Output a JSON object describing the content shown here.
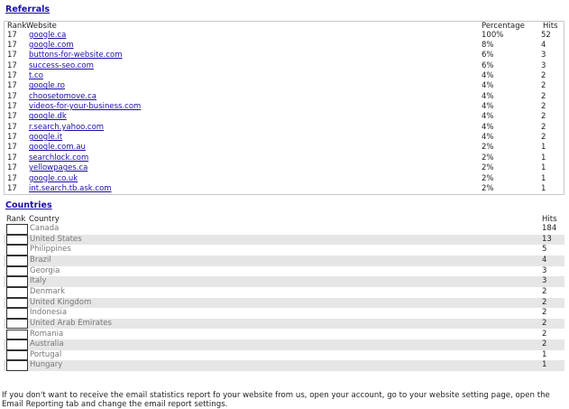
{
  "referrals": {
    "title": "Referrals",
    "headers": {
      "rank": "Rank",
      "website": "Website",
      "percentage": "Percentage",
      "hits": "Hits"
    },
    "rows": [
      {
        "rank": "17",
        "website": "google.ca",
        "percentage": "100%",
        "hits": "52"
      },
      {
        "rank": "17",
        "website": "google.com",
        "percentage": "8%",
        "hits": "4"
      },
      {
        "rank": "17",
        "website": "buttons-for-website.com",
        "percentage": "6%",
        "hits": "3"
      },
      {
        "rank": "17",
        "website": "success-seo.com",
        "percentage": "6%",
        "hits": "3"
      },
      {
        "rank": "17",
        "website": "t.co",
        "percentage": "4%",
        "hits": "2"
      },
      {
        "rank": "17",
        "website": "google.ro",
        "percentage": "4%",
        "hits": "2"
      },
      {
        "rank": "17",
        "website": "choosetomove.ca",
        "percentage": "4%",
        "hits": "2"
      },
      {
        "rank": "17",
        "website": "videos-for-your-business.com",
        "percentage": "4%",
        "hits": "2"
      },
      {
        "rank": "17",
        "website": "google.dk",
        "percentage": "4%",
        "hits": "2"
      },
      {
        "rank": "17",
        "website": "r.search.yahoo.com",
        "percentage": "4%",
        "hits": "2"
      },
      {
        "rank": "17",
        "website": "google.it",
        "percentage": "4%",
        "hits": "2"
      },
      {
        "rank": "17",
        "website": "google.com.au",
        "percentage": "2%",
        "hits": "1"
      },
      {
        "rank": "17",
        "website": "searchlock.com",
        "percentage": "2%",
        "hits": "1"
      },
      {
        "rank": "17",
        "website": "yellowpages.ca",
        "percentage": "2%",
        "hits": "1"
      },
      {
        "rank": "17",
        "website": "google.co.uk",
        "percentage": "2%",
        "hits": "1"
      },
      {
        "rank": "17",
        "website": "int.search.tb.ask.com",
        "percentage": "2%",
        "hits": "1"
      }
    ]
  },
  "countries": {
    "title": "Countries",
    "headers": {
      "rank": "Rank",
      "country": "Country",
      "hits": "Hits"
    },
    "rows": [
      {
        "country": "Canada",
        "hits": "184"
      },
      {
        "country": "United States",
        "hits": "13"
      },
      {
        "country": "Philippines",
        "hits": "5"
      },
      {
        "country": "Brazil",
        "hits": "4"
      },
      {
        "country": "Georgia",
        "hits": "3"
      },
      {
        "country": "Italy",
        "hits": "3"
      },
      {
        "country": "Denmark",
        "hits": "2"
      },
      {
        "country": "United Kingdom",
        "hits": "2"
      },
      {
        "country": "Indonesia",
        "hits": "2"
      },
      {
        "country": "United Arab Emirates",
        "hits": "2"
      },
      {
        "country": "Romania",
        "hits": "2"
      },
      {
        "country": "Australia",
        "hits": "2"
      },
      {
        "country": "Portugal",
        "hits": "1"
      },
      {
        "country": "Hungary",
        "hits": "1"
      }
    ]
  },
  "footer": {
    "text": "If you don't want to receive the email statistics report fo your website from us, open your account, go to your website setting page, open the Email Reporting tab and change the email report settings."
  }
}
